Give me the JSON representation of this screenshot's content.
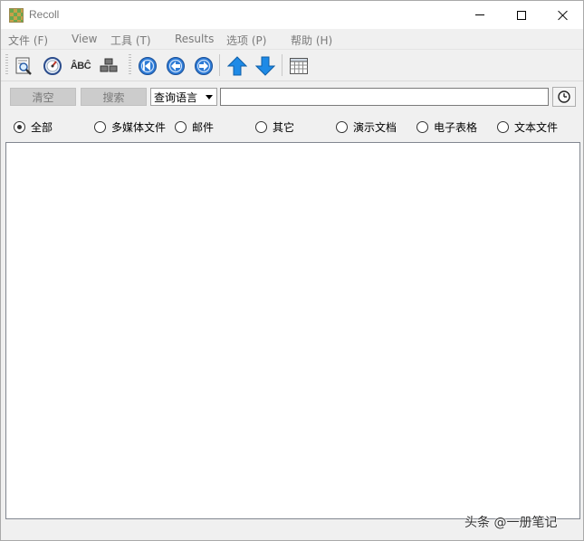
{
  "window": {
    "title": "Recoll"
  },
  "menubar": {
    "items": [
      {
        "label": "文件 (F)"
      },
      {
        "label": "View"
      },
      {
        "label": "工具 (T)"
      },
      {
        "label": "Results"
      },
      {
        "label": "选项 (P)"
      },
      {
        "label": "帮助 (H)"
      }
    ]
  },
  "toolbar": {
    "icons": [
      "document-preview-icon",
      "gauge-icon",
      "spelling-icon",
      "blocks-icon",
      "first-page-icon",
      "previous-page-icon",
      "next-page-icon",
      "sort-ascending-icon",
      "sort-descending-icon",
      "table-view-icon"
    ],
    "spelling_text": "ÂBĈ"
  },
  "search": {
    "clear_label": "清空",
    "search_label": "搜索",
    "query_type": "查询语言",
    "input_value": "",
    "history_icon": "clock-icon"
  },
  "filters": {
    "options": [
      {
        "label": "全部",
        "checked": true
      },
      {
        "label": "多媒体文件",
        "checked": false
      },
      {
        "label": "邮件",
        "checked": false
      },
      {
        "label": "其它",
        "checked": false
      },
      {
        "label": "演示文档",
        "checked": false
      },
      {
        "label": "电子表格",
        "checked": false
      },
      {
        "label": "文本文件",
        "checked": false
      }
    ]
  },
  "watermark": {
    "text": "头条 @一册笔记"
  },
  "colors": {
    "nav_blue": "#2e7bd6",
    "arrow_blue": "#1e8ae6",
    "disabled_text": "#7a7a7a"
  }
}
